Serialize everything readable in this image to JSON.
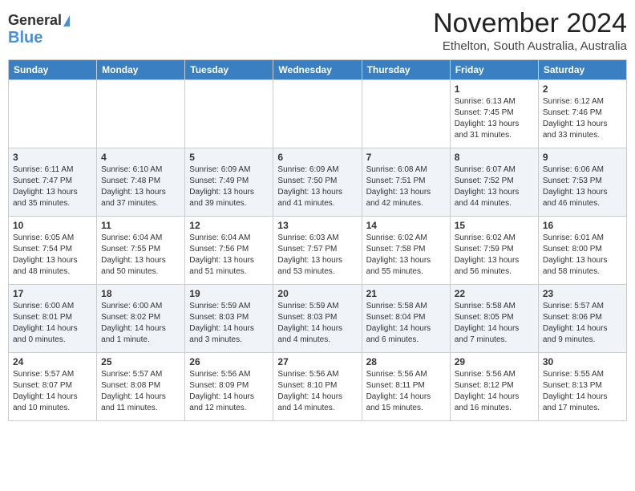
{
  "header": {
    "logo_line1": "General",
    "logo_line2": "Blue",
    "month_year": "November 2024",
    "location": "Ethelton, South Australia, Australia"
  },
  "weekdays": [
    "Sunday",
    "Monday",
    "Tuesday",
    "Wednesday",
    "Thursday",
    "Friday",
    "Saturday"
  ],
  "weeks": [
    [
      {
        "day": "",
        "info": ""
      },
      {
        "day": "",
        "info": ""
      },
      {
        "day": "",
        "info": ""
      },
      {
        "day": "",
        "info": ""
      },
      {
        "day": "",
        "info": ""
      },
      {
        "day": "1",
        "info": "Sunrise: 6:13 AM\nSunset: 7:45 PM\nDaylight: 13 hours\nand 31 minutes."
      },
      {
        "day": "2",
        "info": "Sunrise: 6:12 AM\nSunset: 7:46 PM\nDaylight: 13 hours\nand 33 minutes."
      }
    ],
    [
      {
        "day": "3",
        "info": "Sunrise: 6:11 AM\nSunset: 7:47 PM\nDaylight: 13 hours\nand 35 minutes."
      },
      {
        "day": "4",
        "info": "Sunrise: 6:10 AM\nSunset: 7:48 PM\nDaylight: 13 hours\nand 37 minutes."
      },
      {
        "day": "5",
        "info": "Sunrise: 6:09 AM\nSunset: 7:49 PM\nDaylight: 13 hours\nand 39 minutes."
      },
      {
        "day": "6",
        "info": "Sunrise: 6:09 AM\nSunset: 7:50 PM\nDaylight: 13 hours\nand 41 minutes."
      },
      {
        "day": "7",
        "info": "Sunrise: 6:08 AM\nSunset: 7:51 PM\nDaylight: 13 hours\nand 42 minutes."
      },
      {
        "day": "8",
        "info": "Sunrise: 6:07 AM\nSunset: 7:52 PM\nDaylight: 13 hours\nand 44 minutes."
      },
      {
        "day": "9",
        "info": "Sunrise: 6:06 AM\nSunset: 7:53 PM\nDaylight: 13 hours\nand 46 minutes."
      }
    ],
    [
      {
        "day": "10",
        "info": "Sunrise: 6:05 AM\nSunset: 7:54 PM\nDaylight: 13 hours\nand 48 minutes."
      },
      {
        "day": "11",
        "info": "Sunrise: 6:04 AM\nSunset: 7:55 PM\nDaylight: 13 hours\nand 50 minutes."
      },
      {
        "day": "12",
        "info": "Sunrise: 6:04 AM\nSunset: 7:56 PM\nDaylight: 13 hours\nand 51 minutes."
      },
      {
        "day": "13",
        "info": "Sunrise: 6:03 AM\nSunset: 7:57 PM\nDaylight: 13 hours\nand 53 minutes."
      },
      {
        "day": "14",
        "info": "Sunrise: 6:02 AM\nSunset: 7:58 PM\nDaylight: 13 hours\nand 55 minutes."
      },
      {
        "day": "15",
        "info": "Sunrise: 6:02 AM\nSunset: 7:59 PM\nDaylight: 13 hours\nand 56 minutes."
      },
      {
        "day": "16",
        "info": "Sunrise: 6:01 AM\nSunset: 8:00 PM\nDaylight: 13 hours\nand 58 minutes."
      }
    ],
    [
      {
        "day": "17",
        "info": "Sunrise: 6:00 AM\nSunset: 8:01 PM\nDaylight: 14 hours\nand 0 minutes."
      },
      {
        "day": "18",
        "info": "Sunrise: 6:00 AM\nSunset: 8:02 PM\nDaylight: 14 hours\nand 1 minute."
      },
      {
        "day": "19",
        "info": "Sunrise: 5:59 AM\nSunset: 8:03 PM\nDaylight: 14 hours\nand 3 minutes."
      },
      {
        "day": "20",
        "info": "Sunrise: 5:59 AM\nSunset: 8:03 PM\nDaylight: 14 hours\nand 4 minutes."
      },
      {
        "day": "21",
        "info": "Sunrise: 5:58 AM\nSunset: 8:04 PM\nDaylight: 14 hours\nand 6 minutes."
      },
      {
        "day": "22",
        "info": "Sunrise: 5:58 AM\nSunset: 8:05 PM\nDaylight: 14 hours\nand 7 minutes."
      },
      {
        "day": "23",
        "info": "Sunrise: 5:57 AM\nSunset: 8:06 PM\nDaylight: 14 hours\nand 9 minutes."
      }
    ],
    [
      {
        "day": "24",
        "info": "Sunrise: 5:57 AM\nSunset: 8:07 PM\nDaylight: 14 hours\nand 10 minutes."
      },
      {
        "day": "25",
        "info": "Sunrise: 5:57 AM\nSunset: 8:08 PM\nDaylight: 14 hours\nand 11 minutes."
      },
      {
        "day": "26",
        "info": "Sunrise: 5:56 AM\nSunset: 8:09 PM\nDaylight: 14 hours\nand 12 minutes."
      },
      {
        "day": "27",
        "info": "Sunrise: 5:56 AM\nSunset: 8:10 PM\nDaylight: 14 hours\nand 14 minutes."
      },
      {
        "day": "28",
        "info": "Sunrise: 5:56 AM\nSunset: 8:11 PM\nDaylight: 14 hours\nand 15 minutes."
      },
      {
        "day": "29",
        "info": "Sunrise: 5:56 AM\nSunset: 8:12 PM\nDaylight: 14 hours\nand 16 minutes."
      },
      {
        "day": "30",
        "info": "Sunrise: 5:55 AM\nSunset: 8:13 PM\nDaylight: 14 hours\nand 17 minutes."
      }
    ]
  ]
}
